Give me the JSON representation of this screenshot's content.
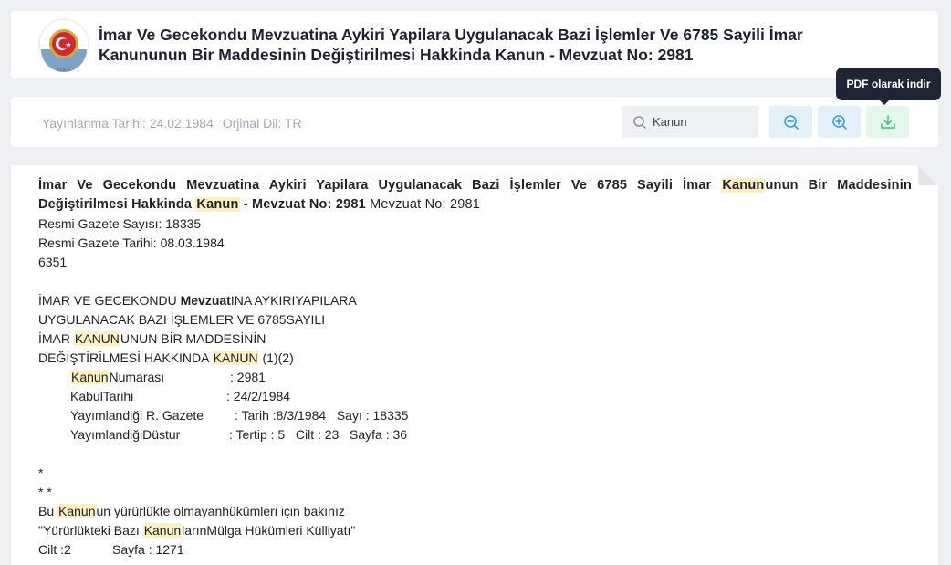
{
  "header": {
    "title": "İmar Ve Gecekondu Mevzuatina Aykiri Yapilara Uygulanacak Bazi İşlemler Ve 6785 Sayili İmar Kanununun Bir Maddesinin Değiştirilmesi Hakkinda Kanun - Mevzuat No: 2981",
    "logo_icon": "tbmm-emblem-icon"
  },
  "toolbar": {
    "published_label": "Yayınlanma Tarihi: 24.02.1984",
    "language_label": "Orjinal Dil: TR",
    "search_value": "Kanun",
    "search_icon": "search-icon",
    "zoom_out_icon": "zoom-out-icon",
    "zoom_in_icon": "zoom-in-icon",
    "download_icon": "download-icon",
    "download_tooltip": "PDF olarak indir"
  },
  "document": {
    "title_part1": "İmar Ve Gecekondu Mevzuatina Aykiri Yapilara Uygulanacak Bazi İşlemler Ve 6785 Sayili İmar ",
    "title_hl1": "Kanun",
    "title_part2": "unun Bir Maddesinin Değiştirilmesi Hakkinda ",
    "title_hl2": "Kanun",
    "title_part3": " - Mevzuat No: 2981",
    "title_tail": " Mevzuat No: 2981",
    "gazette_number": "Resmi Gazete Sayısı: 18335",
    "gazette_date": "Resmi Gazete Tarihi: 08.03.1984",
    "code": "6351",
    "heading1_a": "İMAR VE GECEKONDU ",
    "heading1_b": "Mevzuat",
    "heading1_c": "INA AYKIRIYAPILARA",
    "heading2": "UYGULANACAK BAZI İŞLEMLER VE 6785SAYILI",
    "heading3_a": "İMAR ",
    "heading3_hl": "KANUN",
    "heading3_b": "UNUN BİR MADDESİNİN",
    "heading4_a": "DEĞİŞTİRİLMESİ HAKKINDA ",
    "heading4_hl": "KANUN",
    "heading4_b": " (1)(2)",
    "info_rows": [
      {
        "hl": "Kanun",
        "label": "Numarası",
        "value": ": 2981"
      },
      {
        "hl": "",
        "label": "KabulTarihi",
        "value": ": 24/2/1984"
      },
      {
        "hl": "",
        "label": "Yayımlandiği R. Gazete",
        "value": ": Tarih :8/3/1984   Sayı : 18335"
      },
      {
        "hl": "",
        "label": "YayımlandiğiDüstur",
        "value": ": Tertip : 5   Cilt : 23   Sayfa : 36"
      }
    ],
    "star1": "*",
    "star2": "* *",
    "note1_a": "Bu ",
    "note1_hl": "Kanun",
    "note1_b": "un yürürlükte olmayanhükümleri için bakınız",
    "note2_a": "\"Yürürlükteki Bazı ",
    "note2_hl": "Kanun",
    "note2_b": "larınMülga Hükümleri Külliyatı\"",
    "note3_a": "Cilt :2",
    "note3_b": "Sayfa : 1271"
  },
  "colors": {
    "highlight": "#fdf0c4",
    "zoom_button_bg": "#e3f1fb",
    "download_button_bg": "#e3f7ea",
    "tooltip_bg": "#1f2535"
  }
}
